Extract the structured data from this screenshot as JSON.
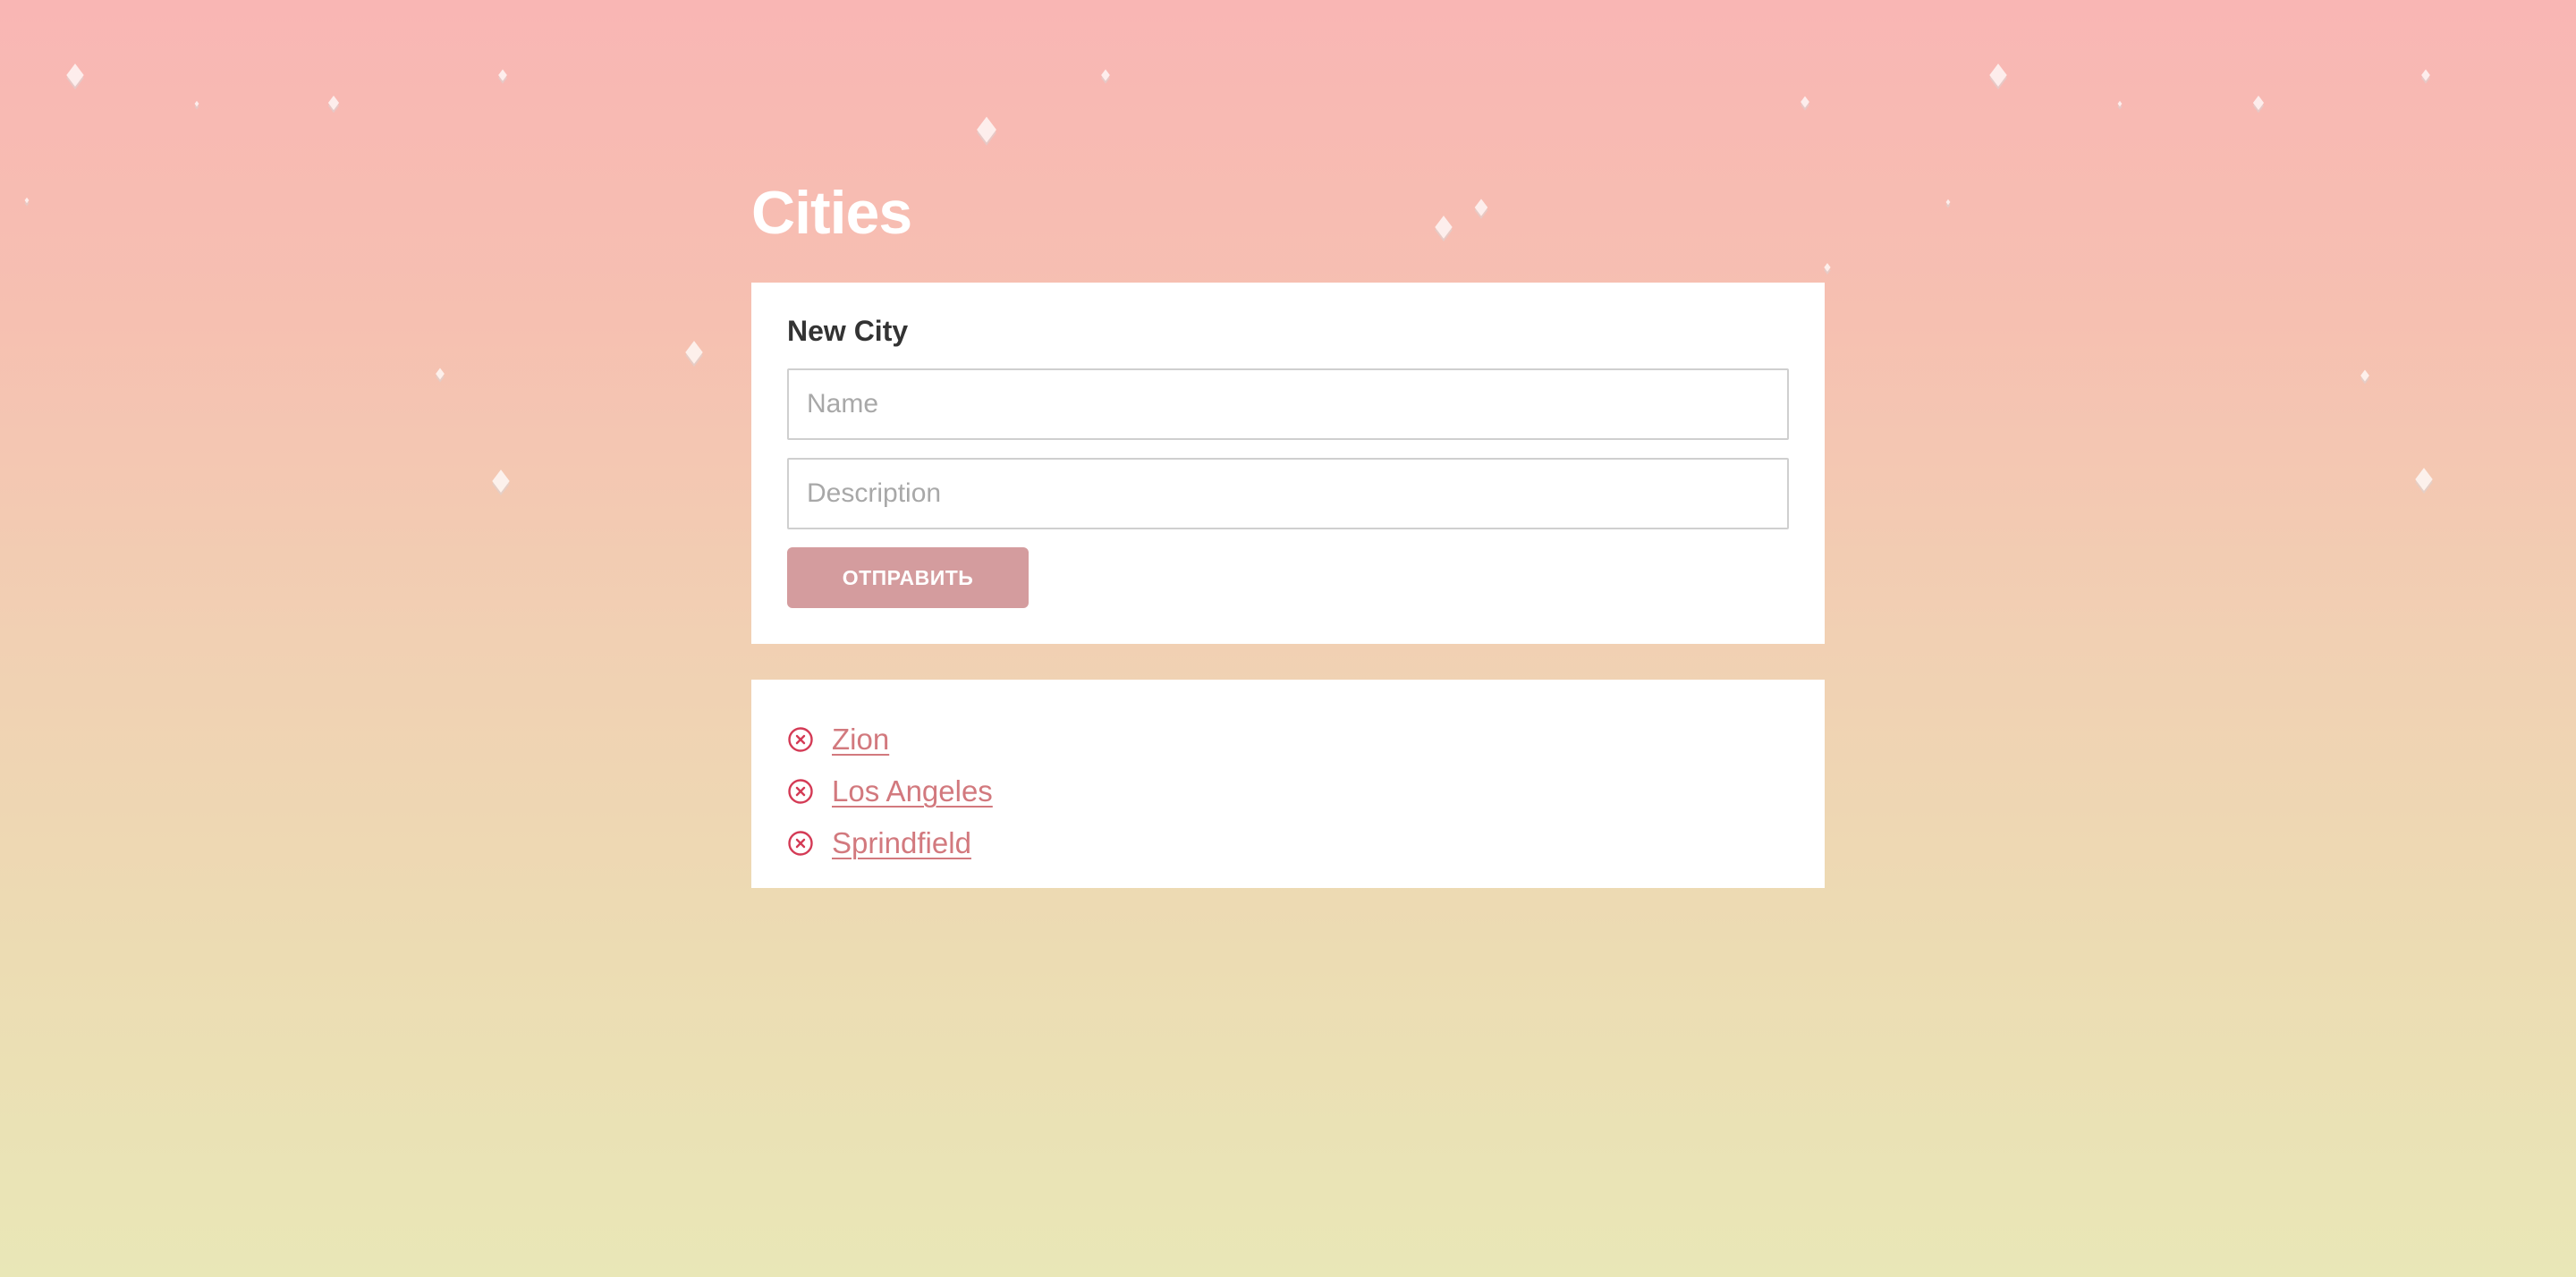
{
  "page": {
    "title": "Cities"
  },
  "form": {
    "heading": "New City",
    "name_placeholder": "Name",
    "description_placeholder": "Description",
    "submit_label": "ОТПРАВИТЬ",
    "submit_color": "#d49c9e"
  },
  "cities": {
    "items": [
      {
        "label": "Zion",
        "icon": "remove-circle-icon"
      },
      {
        "label": "Los Angeles",
        "icon": "remove-circle-icon"
      },
      {
        "label": "Sprindfield",
        "icon": "remove-circle-icon"
      }
    ],
    "link_color": "#d2797e",
    "remove_icon_color": "#d43a55"
  },
  "background": {
    "gradient_top": "#f9b6b4",
    "gradient_bottom": "#e9e7b7",
    "decoration": "floating-white-cubes"
  }
}
